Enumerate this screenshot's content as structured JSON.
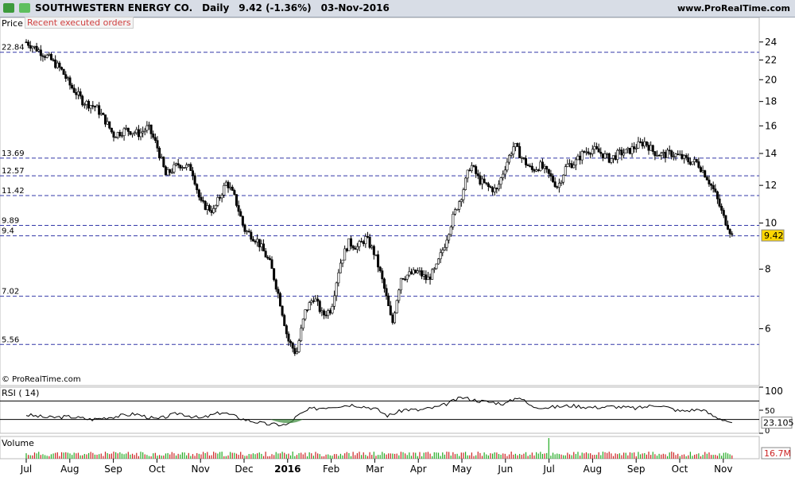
{
  "header": {
    "symbol": "SOUTHWESTERN ENERGY CO.",
    "period": "Daily",
    "quote": "9.42 (-1.36%)",
    "date": "03-Nov-2016",
    "site": "www.ProRealTime.com"
  },
  "panels": {
    "price_label": "Price",
    "recent_orders_label": "Recent executed orders",
    "copyright": "© ProRealTime.com",
    "rsi_label": "RSI ( 14)",
    "volume_label": "Volume"
  },
  "colors": {
    "candle": "#000000",
    "hline": "#3338a8",
    "rsi": "#000000",
    "volume_up": "#22aa22",
    "volume_down": "#cc2222"
  },
  "chart_data": [
    {
      "type": "candlestick",
      "title": "SOUTHWESTERN ENERGY CO. Daily",
      "scale": "log",
      "ylim": [
        4.7,
        26
      ],
      "y_ticks": [
        24,
        22,
        20,
        18,
        16,
        14,
        12,
        10,
        8,
        6
      ],
      "x_labels": [
        "Jul",
        "Aug",
        "Sep",
        "Oct",
        "Nov",
        "Dec",
        "2016",
        "Feb",
        "Mar",
        "Apr",
        "May",
        "Jun",
        "Jul",
        "Aug",
        "Sep",
        "Oct",
        "Nov"
      ],
      "x_positions": [
        0,
        1,
        2,
        3,
        4,
        5,
        6,
        7,
        8,
        9,
        10,
        11,
        12,
        13,
        14,
        15,
        16
      ],
      "horizontal_levels": [
        22.84,
        13.69,
        12.57,
        11.42,
        9.89,
        9.4,
        7.02,
        5.56
      ],
      "last_price": 9.42,
      "approx_close_path": [
        {
          "x": 0.0,
          "y": 24.0
        },
        {
          "x": 0.3,
          "y": 23.0
        },
        {
          "x": 0.5,
          "y": 22.3
        },
        {
          "x": 0.8,
          "y": 21.0
        },
        {
          "x": 1.0,
          "y": 19.5
        },
        {
          "x": 1.3,
          "y": 18.0
        },
        {
          "x": 1.6,
          "y": 17.5
        },
        {
          "x": 1.8,
          "y": 16.5
        },
        {
          "x": 2.0,
          "y": 15.3
        },
        {
          "x": 2.3,
          "y": 15.7
        },
        {
          "x": 2.6,
          "y": 15.4
        },
        {
          "x": 2.8,
          "y": 15.9
        },
        {
          "x": 3.0,
          "y": 14.5
        },
        {
          "x": 3.2,
          "y": 12.6
        },
        {
          "x": 3.5,
          "y": 13.3
        },
        {
          "x": 3.8,
          "y": 13.0
        },
        {
          "x": 4.0,
          "y": 11.0
        },
        {
          "x": 4.3,
          "y": 10.6
        },
        {
          "x": 4.6,
          "y": 12.2
        },
        {
          "x": 4.8,
          "y": 11.2
        },
        {
          "x": 5.0,
          "y": 9.7
        },
        {
          "x": 5.3,
          "y": 9.2
        },
        {
          "x": 5.6,
          "y": 8.2
        },
        {
          "x": 5.8,
          "y": 7.0
        },
        {
          "x": 6.0,
          "y": 5.7
        },
        {
          "x": 6.2,
          "y": 5.3
        },
        {
          "x": 6.4,
          "y": 6.5
        },
        {
          "x": 6.6,
          "y": 7.0
        },
        {
          "x": 6.8,
          "y": 6.4
        },
        {
          "x": 7.0,
          "y": 6.6
        },
        {
          "x": 7.2,
          "y": 8.2
        },
        {
          "x": 7.4,
          "y": 9.1
        },
        {
          "x": 7.6,
          "y": 8.9
        },
        {
          "x": 7.8,
          "y": 9.3
        },
        {
          "x": 8.0,
          "y": 8.6
        },
        {
          "x": 8.2,
          "y": 7.4
        },
        {
          "x": 8.4,
          "y": 6.1
        },
        {
          "x": 8.6,
          "y": 7.7
        },
        {
          "x": 8.8,
          "y": 7.8
        },
        {
          "x": 9.0,
          "y": 7.9
        },
        {
          "x": 9.2,
          "y": 7.6
        },
        {
          "x": 9.4,
          "y": 8.0
        },
        {
          "x": 9.6,
          "y": 9.0
        },
        {
          "x": 9.8,
          "y": 10.3
        },
        {
          "x": 10.0,
          "y": 11.5
        },
        {
          "x": 10.2,
          "y": 13.3
        },
        {
          "x": 10.4,
          "y": 12.3
        },
        {
          "x": 10.6,
          "y": 11.9
        },
        {
          "x": 10.8,
          "y": 11.7
        },
        {
          "x": 11.0,
          "y": 13.2
        },
        {
          "x": 11.2,
          "y": 14.6
        },
        {
          "x": 11.4,
          "y": 13.6
        },
        {
          "x": 11.6,
          "y": 12.9
        },
        {
          "x": 11.8,
          "y": 13.2
        },
        {
          "x": 12.0,
          "y": 12.6
        },
        {
          "x": 12.2,
          "y": 11.9
        },
        {
          "x": 12.4,
          "y": 13.2
        },
        {
          "x": 12.6,
          "y": 13.4
        },
        {
          "x": 12.8,
          "y": 14.1
        },
        {
          "x": 13.0,
          "y": 14.3
        },
        {
          "x": 13.2,
          "y": 14.0
        },
        {
          "x": 13.4,
          "y": 13.6
        },
        {
          "x": 13.6,
          "y": 14.0
        },
        {
          "x": 13.8,
          "y": 14.1
        },
        {
          "x": 14.0,
          "y": 14.5
        },
        {
          "x": 14.2,
          "y": 14.8
        },
        {
          "x": 14.4,
          "y": 14.1
        },
        {
          "x": 14.6,
          "y": 13.9
        },
        {
          "x": 14.8,
          "y": 14.0
        },
        {
          "x": 15.0,
          "y": 13.8
        },
        {
          "x": 15.2,
          "y": 13.5
        },
        {
          "x": 15.4,
          "y": 13.4
        },
        {
          "x": 15.6,
          "y": 12.6
        },
        {
          "x": 15.8,
          "y": 11.6
        },
        {
          "x": 16.0,
          "y": 10.3
        },
        {
          "x": 16.1,
          "y": 9.9
        },
        {
          "x": 16.2,
          "y": 9.42
        }
      ]
    },
    {
      "type": "line",
      "title": "RSI ( 14)",
      "ylim": [
        0,
        100
      ],
      "y_ticks": [
        100,
        50,
        0
      ],
      "levels": [
        70,
        30
      ],
      "last_value": 23.105,
      "approx_path": [
        {
          "x": 0.0,
          "y": 40
        },
        {
          "x": 0.5,
          "y": 34
        },
        {
          "x": 1.0,
          "y": 36
        },
        {
          "x": 1.5,
          "y": 30
        },
        {
          "x": 2.0,
          "y": 36
        },
        {
          "x": 2.5,
          "y": 42
        },
        {
          "x": 3.0,
          "y": 30
        },
        {
          "x": 3.5,
          "y": 44
        },
        {
          "x": 4.0,
          "y": 32
        },
        {
          "x": 4.5,
          "y": 46
        },
        {
          "x": 5.0,
          "y": 30
        },
        {
          "x": 5.5,
          "y": 20
        },
        {
          "x": 6.0,
          "y": 18
        },
        {
          "x": 6.2,
          "y": 36
        },
        {
          "x": 6.5,
          "y": 52
        },
        {
          "x": 7.0,
          "y": 58
        },
        {
          "x": 7.5,
          "y": 62
        },
        {
          "x": 8.0,
          "y": 54
        },
        {
          "x": 8.3,
          "y": 38
        },
        {
          "x": 8.7,
          "y": 52
        },
        {
          "x": 9.0,
          "y": 50
        },
        {
          "x": 9.5,
          "y": 58
        },
        {
          "x": 10.0,
          "y": 78
        },
        {
          "x": 10.4,
          "y": 70
        },
        {
          "x": 11.0,
          "y": 64
        },
        {
          "x": 11.3,
          "y": 80
        },
        {
          "x": 11.6,
          "y": 58
        },
        {
          "x": 12.0,
          "y": 56
        },
        {
          "x": 12.5,
          "y": 60
        },
        {
          "x": 13.0,
          "y": 56
        },
        {
          "x": 13.5,
          "y": 58
        },
        {
          "x": 14.0,
          "y": 54
        },
        {
          "x": 14.5,
          "y": 62
        },
        {
          "x": 15.0,
          "y": 48
        },
        {
          "x": 15.5,
          "y": 52
        },
        {
          "x": 15.8,
          "y": 36
        },
        {
          "x": 16.0,
          "y": 30
        },
        {
          "x": 16.2,
          "y": 23.105
        }
      ]
    },
    {
      "type": "bar",
      "title": "Volume",
      "last_value": "16.7M",
      "note": "daily volume bars; spike near early July 2016"
    }
  ]
}
